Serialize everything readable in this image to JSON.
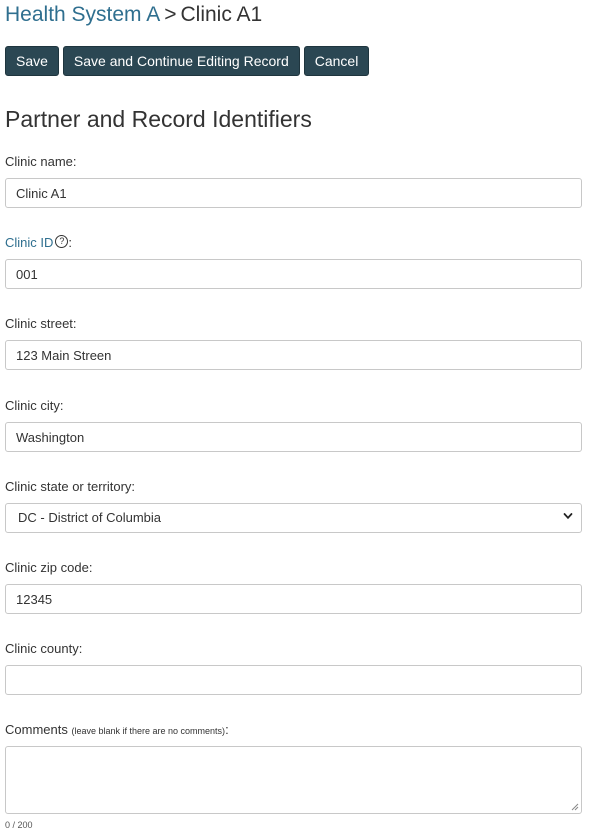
{
  "breadcrumb": {
    "parent": "Health System A",
    "separator": ">",
    "current": "Clinic A1"
  },
  "toolbar": {
    "save_label": "Save",
    "save_continue_label": "Save and Continue Editing Record",
    "cancel_label": "Cancel"
  },
  "section": {
    "title": "Partner and Record Identifiers"
  },
  "fields": {
    "clinic_name": {
      "label": "Clinic name:",
      "value": "Clinic A1"
    },
    "clinic_id": {
      "label": "Clinic ID",
      "colon": ":",
      "help": "?",
      "value": "001"
    },
    "clinic_street": {
      "label": "Clinic street:",
      "value": "123 Main Streen"
    },
    "clinic_city": {
      "label": "Clinic city:",
      "value": "Washington"
    },
    "clinic_state": {
      "label": "Clinic state or territory:",
      "value": "DC - District of Columbia"
    },
    "clinic_zip": {
      "label": "Clinic zip code:",
      "value": "12345"
    },
    "clinic_county": {
      "label": "Clinic county:",
      "value": ""
    },
    "comments": {
      "label": "Comments",
      "hint": "(leave blank if there are no comments)",
      "colon": ":",
      "value": "",
      "counter": "0 / 200"
    }
  }
}
